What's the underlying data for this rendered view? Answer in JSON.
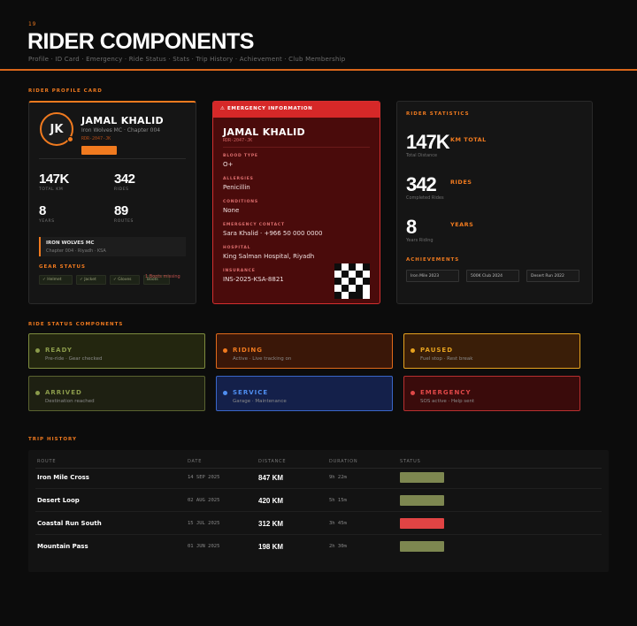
{
  "header": {
    "number": "19",
    "title": "RIDER COMPONENTS",
    "subtitle": "Profile · ID Card · Emergency · Ride Status · Stats · Trip History · Achievement · Club Membership"
  },
  "sections": {
    "profile": "RIDER PROFILE CARD",
    "status": "RIDE STATUS COMPONENTS",
    "trips": "TRIP HISTORY"
  },
  "profile": {
    "initials": "JK",
    "name": "JAMAL KHALID",
    "club_line": "Iron Wolves MC · Chapter 004",
    "rider_id": "RDR-2047-JK",
    "stats": [
      {
        "value": "147K",
        "label": "TOTAL KM"
      },
      {
        "value": "342",
        "label": "RIDES"
      },
      {
        "value": "8",
        "label": "YEARS"
      },
      {
        "value": "89",
        "label": "ROUTES"
      }
    ],
    "club_name": "IRON WOLVES MC",
    "club_detail": "Chapter 004 · Riyadh · KSA",
    "gear_title": "GEAR STATUS",
    "gear": [
      "✓ Helmet",
      "✓ Jacket",
      "✓ Gloves",
      "Boots"
    ],
    "gear_missing": "1 Boots missing"
  },
  "emergency": {
    "header": "EMERGENCY INFORMATION",
    "name": "JAMAL KHALID",
    "rider_id": "RDR-2047-JK",
    "fields": [
      {
        "label": "BLOOD TYPE",
        "value": "O+"
      },
      {
        "label": "ALLERGIES",
        "value": "Penicillin"
      },
      {
        "label": "CONDITIONS",
        "value": "None"
      },
      {
        "label": "EMERGENCY CONTACT",
        "value": "Sara Khalid · +966 50 000 0000"
      },
      {
        "label": "HOSPITAL",
        "value": "King Salman Hospital, Riyadh"
      },
      {
        "label": "INSURANCE",
        "value": "INS-2025-KSA-8821"
      }
    ]
  },
  "rider_stats": {
    "title": "RIDER STATISTICS",
    "items": [
      {
        "value": "147K",
        "unit": "KM TOTAL",
        "sub": "Total Distance"
      },
      {
        "value": "342",
        "unit": "RIDES",
        "sub": "Completed Rides"
      },
      {
        "value": "8",
        "unit": "YEARS",
        "sub": "Years Riding"
      }
    ],
    "achievements_title": "ACHIEVEMENTS",
    "achievements": [
      "Iron Mile 2023",
      "500K Club 2024",
      "Desert Run 2022"
    ]
  },
  "ride_status": [
    {
      "name": "READY",
      "desc": "Pre-ride · Gear checked",
      "color": "#8a9a4a",
      "bg": "#23260f",
      "border": "#7d8b3e"
    },
    {
      "name": "RIDING",
      "desc": "Active · Live tracking on",
      "color": "#f07a1f",
      "bg": "#3a1708",
      "border": "#e06a1a"
    },
    {
      "name": "PAUSED",
      "desc": "Fuel stop · Rest break",
      "color": "#e6a21f",
      "bg": "#3a1e08",
      "border": "#e6a21f"
    },
    {
      "name": "ARRIVED",
      "desc": "Destination reached",
      "color": "#8a9a4a",
      "bg": "#1e2012",
      "border": "#5a6330"
    },
    {
      "name": "SERVICE",
      "desc": "Garage · Maintenance",
      "color": "#4f8ef0",
      "bg": "#14204a",
      "border": "#3a66c8"
    },
    {
      "name": "EMERGENCY",
      "desc": "SOS active · Help sent",
      "color": "#e04848",
      "bg": "#3a0b0b",
      "border": "#b83030"
    }
  ],
  "trips": {
    "columns": [
      "ROUTE",
      "DATE",
      "DISTANCE",
      "DURATION",
      "STATUS"
    ],
    "rows": [
      {
        "route": "Iron Mile Cross",
        "date": "14 SEP 2025",
        "distance": "847 KM",
        "duration": "9h 22m",
        "status_color": "#7d8750"
      },
      {
        "route": "Desert Loop",
        "date": "02 AUG 2025",
        "distance": "420 KM",
        "duration": "5h 15m",
        "status_color": "#7d8750"
      },
      {
        "route": "Coastal Run South",
        "date": "15 JUL 2025",
        "distance": "312 KM",
        "duration": "3h 45m",
        "status_color": "#e04444"
      },
      {
        "route": "Mountain Pass",
        "date": "01 JUN 2025",
        "distance": "198 KM",
        "duration": "2h 30m",
        "status_color": "#7d8750"
      }
    ]
  }
}
